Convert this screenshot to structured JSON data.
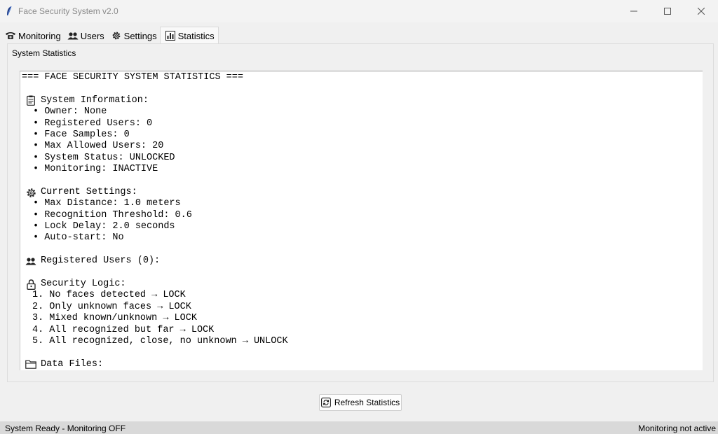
{
  "window": {
    "title": "Face Security System v2.0"
  },
  "tabs": [
    {
      "label": "Monitoring",
      "icon": "telephone-icon"
    },
    {
      "label": "Users",
      "icon": "users-icon"
    },
    {
      "label": "Settings",
      "icon": "gear-icon"
    },
    {
      "label": "Statistics",
      "icon": "bar-chart-icon"
    }
  ],
  "active_tab": "Statistics",
  "panel": {
    "label": "System Statistics"
  },
  "stats": {
    "header": "=== FACE SECURITY SYSTEM STATISTICS ===",
    "system_info": {
      "title": "System Information:",
      "items": [
        "• Owner: None",
        "• Registered Users: 0",
        "• Face Samples: 0",
        "• Max Allowed Users: 20",
        "• System Status: UNLOCKED",
        "• Monitoring: INACTIVE"
      ]
    },
    "settings": {
      "title": "Current Settings:",
      "items": [
        "• Max Distance: 1.0 meters",
        "• Recognition Threshold: 0.6",
        "• Lock Delay: 2.0 seconds",
        "• Auto-start: No"
      ]
    },
    "users": {
      "title": "Registered Users (0):"
    },
    "logic": {
      "title": "Security Logic:",
      "items": [
        "1. No faces detected → LOCK",
        "2. Only unknown faces → LOCK",
        "3. Mixed known/unknown → LOCK",
        "4. All recognized but far → LOCK",
        "5. All recognized, close, no unknown → UNLOCK"
      ]
    },
    "data_files": {
      "title": "Data Files:"
    }
  },
  "refresh_button": {
    "label": "Refresh Statistics"
  },
  "statusbar": {
    "left": "System Ready - Monitoring OFF",
    "right": "Monitoring not active"
  }
}
